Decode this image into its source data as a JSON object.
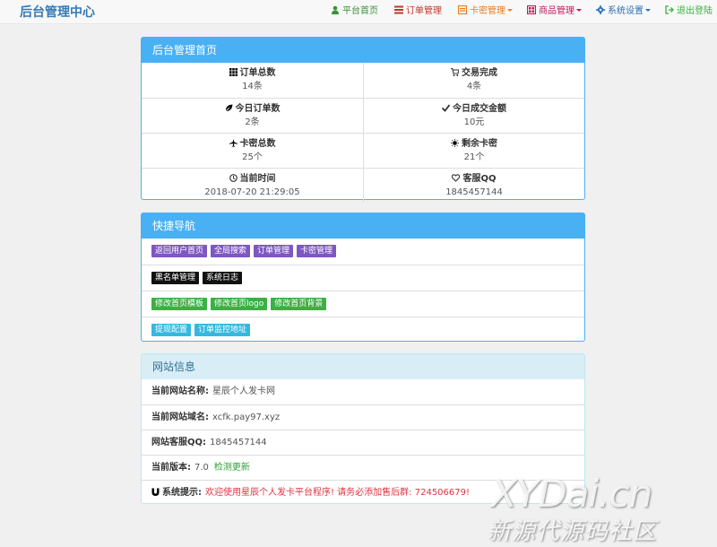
{
  "brand": "后台管理中心",
  "colors": {
    "accent": "#4ab0f4",
    "brand": "#337ab7",
    "danger": "#e0323f",
    "success": "#2e9e35"
  },
  "nav": [
    {
      "label": "平台首页",
      "icon": "user-icon",
      "color": "#3a8f3a",
      "dropdown": false
    },
    {
      "label": "订单管理",
      "icon": "list-icon",
      "color": "#c0392b",
      "dropdown": false
    },
    {
      "label": "卡密管理",
      "icon": "card-icon",
      "color": "#e67e22",
      "dropdown": true
    },
    {
      "label": "商品管理",
      "icon": "grid-icon",
      "color": "#c2185b",
      "dropdown": true
    },
    {
      "label": "系统设置",
      "icon": "gear-icon",
      "color": "#2c6fb5",
      "dropdown": true
    },
    {
      "label": "退出登陆",
      "icon": "logout-icon",
      "color": "#3cb043",
      "dropdown": false
    }
  ],
  "home_panel": {
    "title": "后台管理首页",
    "stats": [
      {
        "label": "订单总数",
        "value": "14条",
        "icon": "th-icon"
      },
      {
        "label": "交易完成",
        "value": "4条",
        "icon": "cart-icon"
      },
      {
        "label": "今日订单数",
        "value": "2条",
        "icon": "leaf-icon"
      },
      {
        "label": "今日成交金额",
        "value": "10元",
        "icon": "check-icon"
      },
      {
        "label": "卡密总数",
        "value": "25个",
        "icon": "plane-icon"
      },
      {
        "label": "剩余卡密",
        "value": "21个",
        "icon": "sun-icon"
      },
      {
        "label": "当前时间",
        "value": "2018-07-20 21:29:05",
        "icon": "clock-icon"
      },
      {
        "label": "客服QQ",
        "value": "1845457144",
        "icon": "heart-icon"
      }
    ]
  },
  "quick_nav": {
    "title": "快捷导航",
    "rows": [
      [
        {
          "label": "返回用户首页",
          "style": "purple"
        },
        {
          "label": "全局搜索",
          "style": "purple"
        },
        {
          "label": "订单管理",
          "style": "purple"
        },
        {
          "label": "卡密管理",
          "style": "purple"
        }
      ],
      [
        {
          "label": "黑名单管理",
          "style": "black"
        },
        {
          "label": "系统日志",
          "style": "black"
        }
      ],
      [
        {
          "label": "修改首页模板",
          "style": "green"
        },
        {
          "label": "修改首页logo",
          "style": "green"
        },
        {
          "label": "修改首页背景",
          "style": "green"
        }
      ],
      [
        {
          "label": "提现配置",
          "style": "cyan"
        },
        {
          "label": "订单监控地址",
          "style": "cyan"
        }
      ]
    ]
  },
  "site_info": {
    "title": "网站信息",
    "name_label": "当前网站名称:",
    "name_value": "星辰个人发卡网",
    "domain_label": "当前网站域名:",
    "domain_value": "xcfk.pay97.xyz",
    "qq_label": "网站客服QQ:",
    "qq_value": "1845457144",
    "version_label": "当前版本:",
    "version_value": "7.0",
    "check_update": "检测更新",
    "notice_label": "系统提示:",
    "notice_text": "欢迎使用星辰个人发卡平台程序! 请务必添加售后群: 724506679!"
  },
  "watermark": {
    "line1": "XYDai.cn",
    "line2": "新源代源码社区"
  }
}
